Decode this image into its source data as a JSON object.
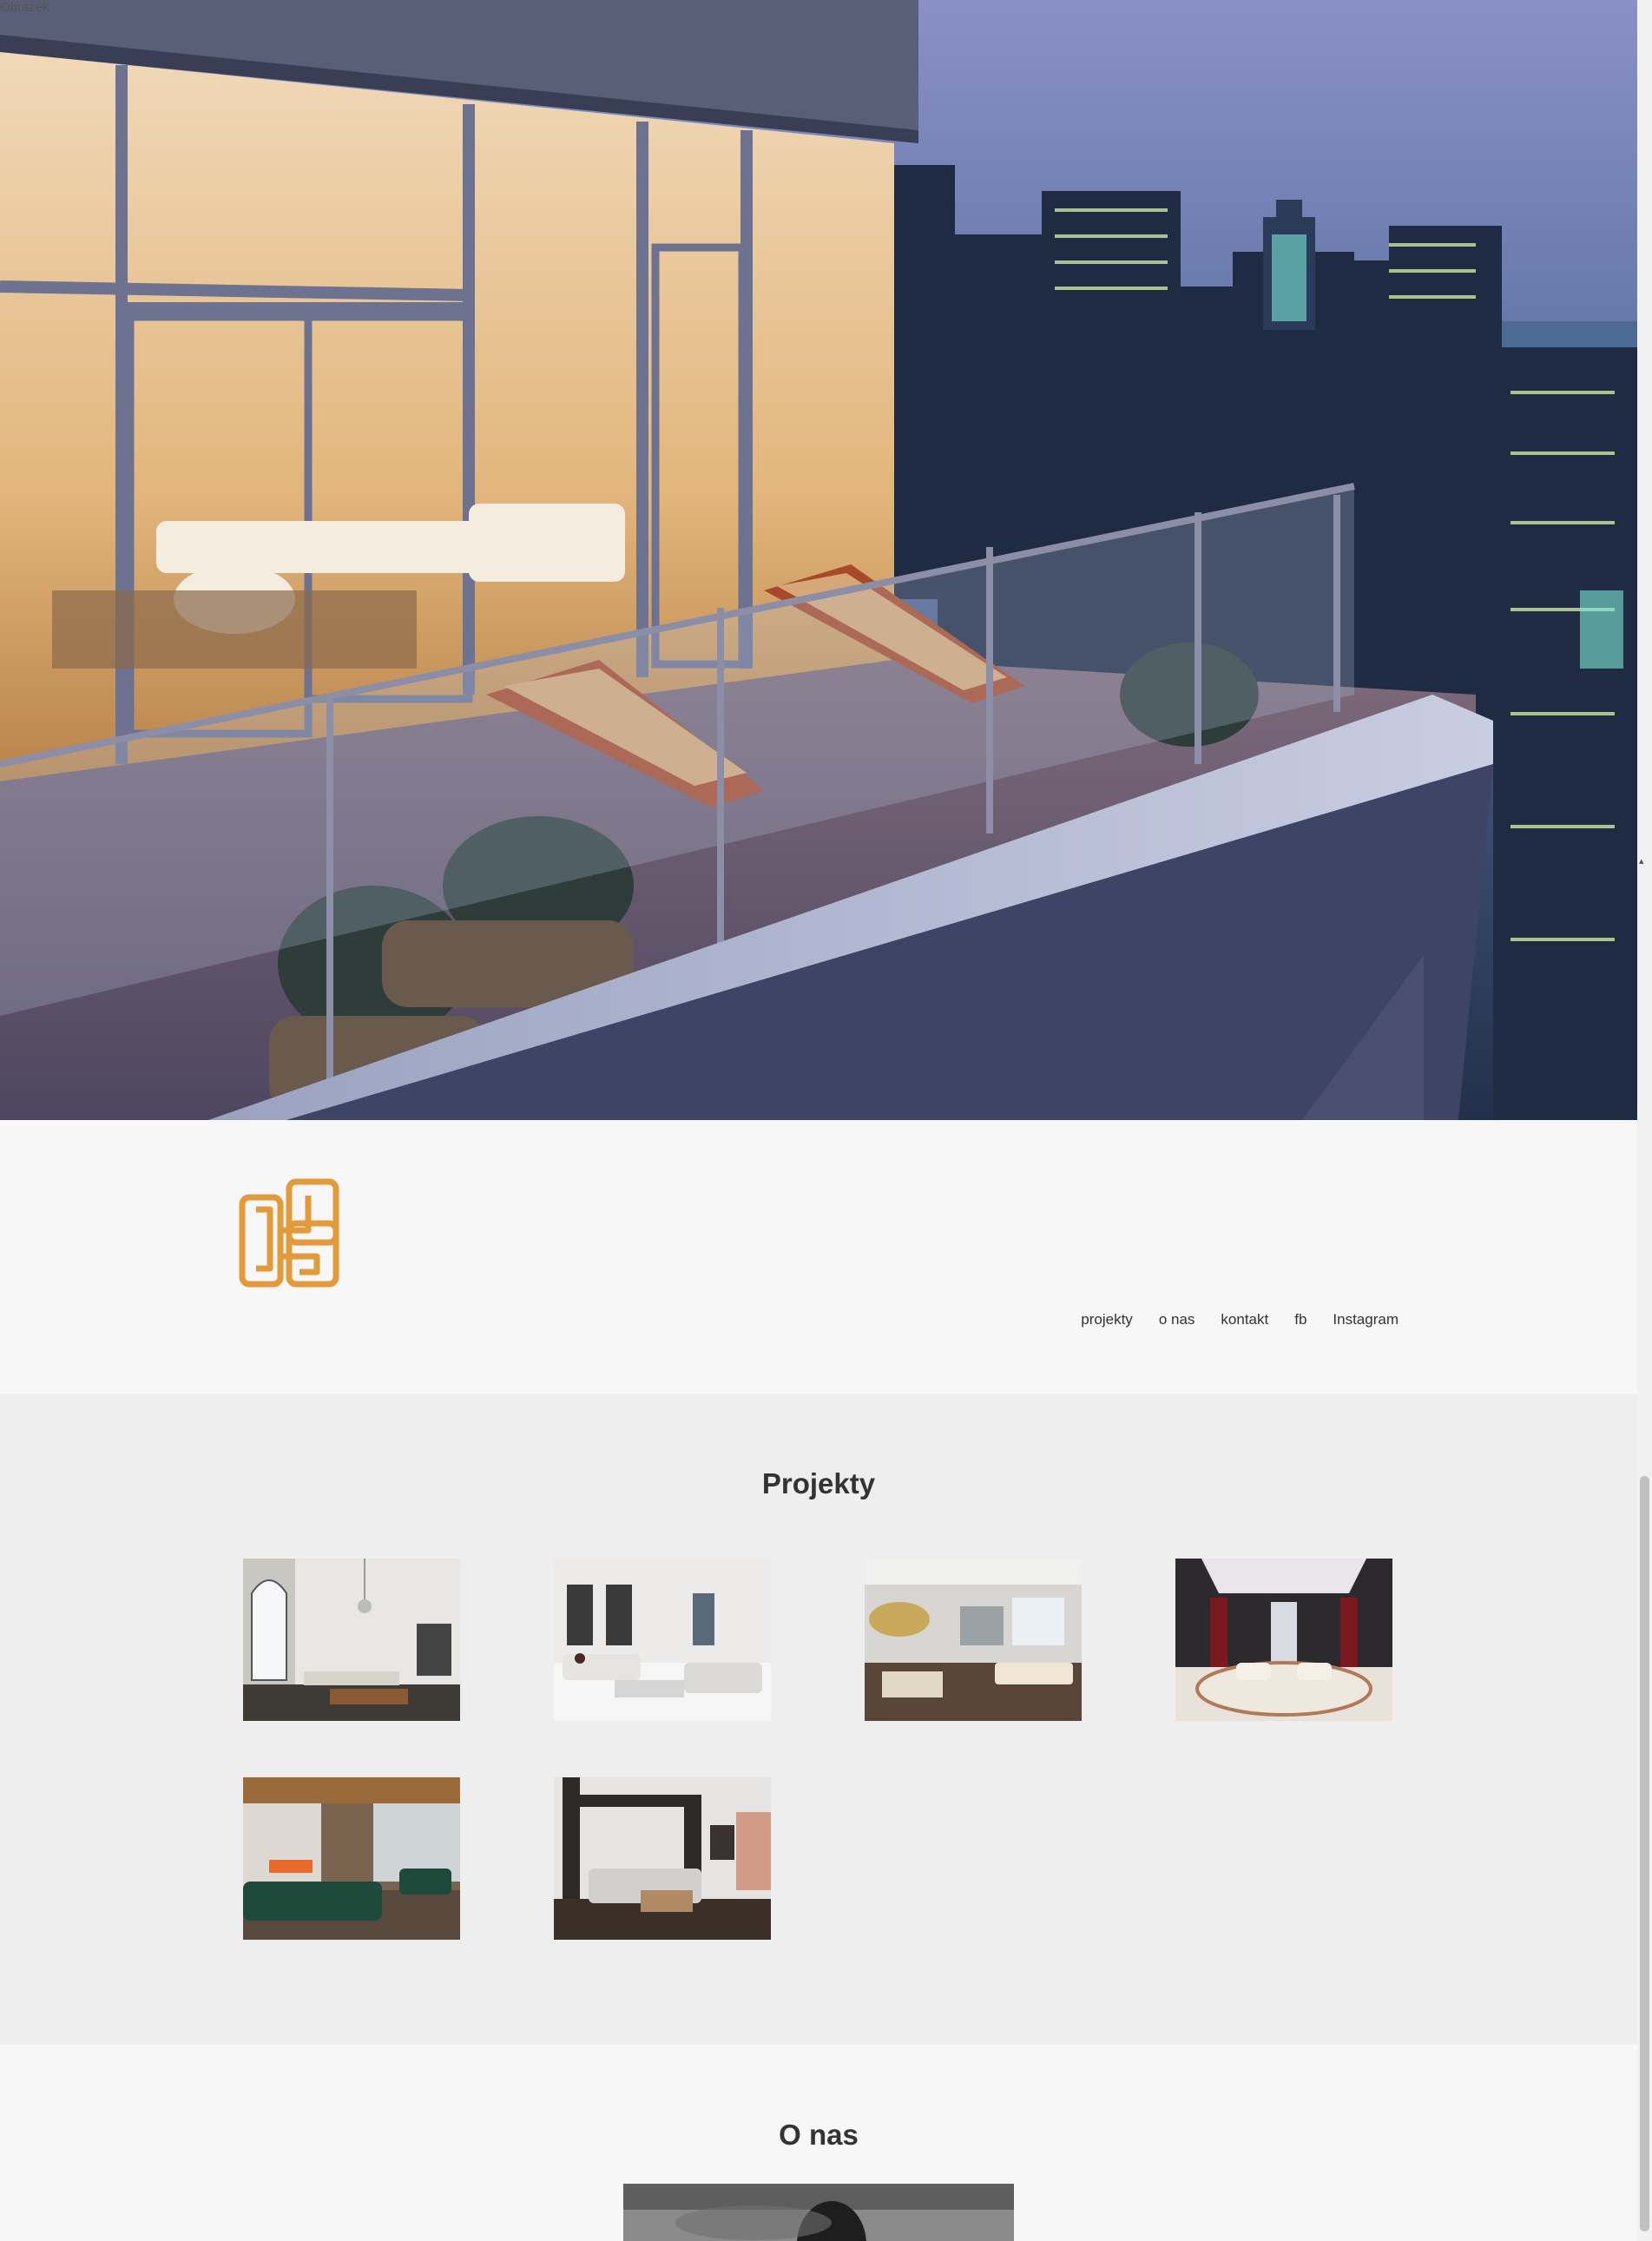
{
  "hero": {
    "image_alt": "Obrazek"
  },
  "nav": {
    "items": [
      {
        "label": "projekty"
      },
      {
        "label": "o nas"
      },
      {
        "label": "kontakt"
      },
      {
        "label": "fb"
      },
      {
        "label": "Instagram"
      }
    ]
  },
  "projects": {
    "title": "Projekty",
    "items": [
      {
        "name": "project-1",
        "icon": "interior-photo"
      },
      {
        "name": "project-2",
        "icon": "interior-photo"
      },
      {
        "name": "project-3",
        "icon": "interior-photo"
      },
      {
        "name": "project-4",
        "icon": "interior-photo"
      },
      {
        "name": "project-5",
        "icon": "interior-photo"
      },
      {
        "name": "project-6",
        "icon": "interior-photo"
      }
    ]
  },
  "about": {
    "title": "O nas"
  },
  "colors": {
    "logo": "#e39a3a",
    "text": "#333333",
    "projects_bg": "#eeeeee",
    "page_bg": "#f7f7f7"
  }
}
